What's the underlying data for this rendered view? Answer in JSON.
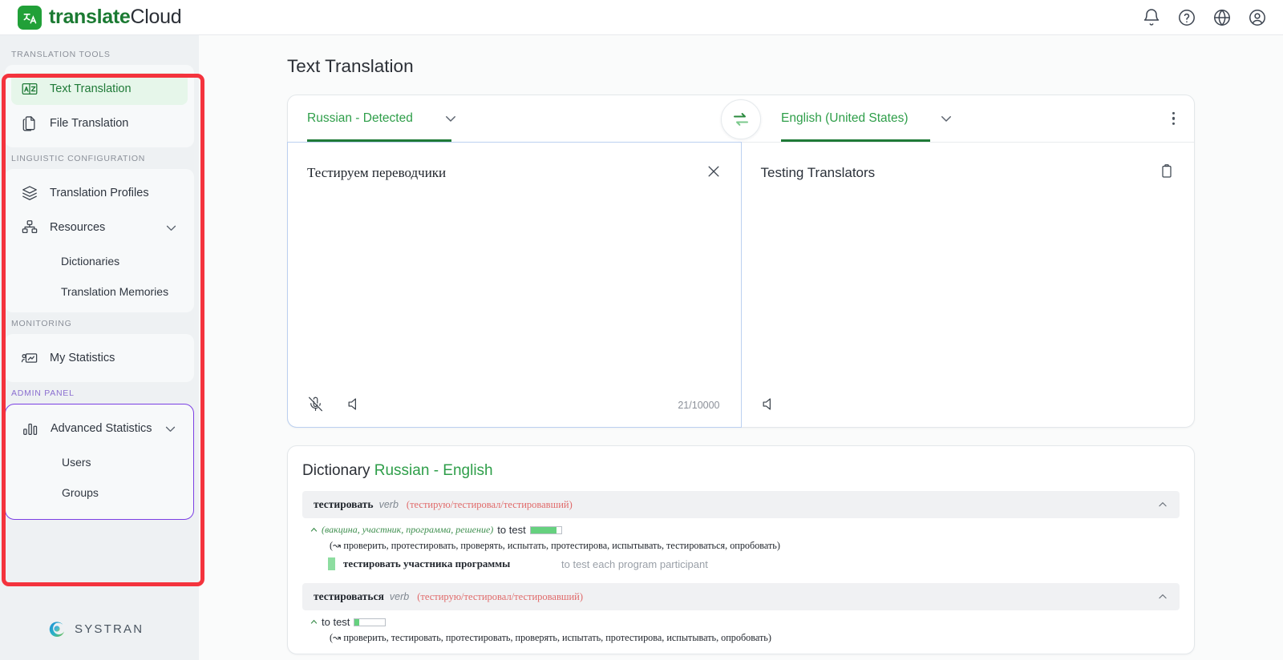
{
  "brand": {
    "part1": "translate",
    "part2": "Cloud",
    "logo_icon": "translate-logo-icon"
  },
  "topbar": {
    "icons": [
      {
        "name": "notifications-icon",
        "label": "Notifications"
      },
      {
        "name": "help-icon",
        "label": "Help"
      },
      {
        "name": "language-globe-icon",
        "label": "Language"
      },
      {
        "name": "account-icon",
        "label": "Account"
      }
    ]
  },
  "sidebar": {
    "sections": [
      {
        "label": "TRANSLATION TOOLS"
      },
      {
        "label": "LINGUISTIC CONFIGURATION"
      },
      {
        "label": "MONITORING"
      },
      {
        "label": "ADMIN PANEL"
      }
    ],
    "items": {
      "text_translation": "Text Translation",
      "file_translation": "File Translation",
      "translation_profiles": "Translation Profiles",
      "resources": "Resources",
      "dictionaries": "Dictionaries",
      "translation_memories": "Translation Memories",
      "my_statistics": "My Statistics",
      "advanced_statistics": "Advanced Statistics",
      "users": "Users",
      "groups": "Groups"
    },
    "footer_brand": "SYSTRAN"
  },
  "main": {
    "page_title": "Text Translation",
    "source": {
      "language": "Russian - Detected",
      "text": "Тестируем переводчики",
      "char_count": "21/10000",
      "clear_label": "×"
    },
    "target": {
      "language": "English (United States)",
      "text": "Testing Translators"
    },
    "swap_label": "Swap languages"
  },
  "dictionary": {
    "title": "Dictionary",
    "pair": "Russian - English",
    "entries": [
      {
        "lemma": "тестировать",
        "pos": "verb",
        "forms": "(тестирую/тестировал/тестировавший)",
        "senses": [
          {
            "context": "(вакцина, участник, программа, решение)",
            "translation": "to test",
            "confidence": 85,
            "synonyms": "(↝ проверить, протестировать, проверять, испытать, протестирова, испытывать, тестироваться, опробовать)",
            "examples": [
              {
                "source": "тестировать участника программы",
                "target": "to test each program participant"
              }
            ]
          }
        ]
      },
      {
        "lemma": "тестироваться",
        "pos": "verb",
        "forms": "(тестирую/тестировал/тестировавший)",
        "senses": [
          {
            "context": "",
            "translation": "to test",
            "confidence": 14,
            "synonyms": "(↝ проверить, тестировать, протестировать, проверять, испытать, протестирова, испытывать, опробовать)",
            "examples": []
          }
        ]
      }
    ]
  },
  "annotations": {
    "sidebar_highlight_color": "#f4333d",
    "admin_highlight_color": "#7b3fe4"
  }
}
